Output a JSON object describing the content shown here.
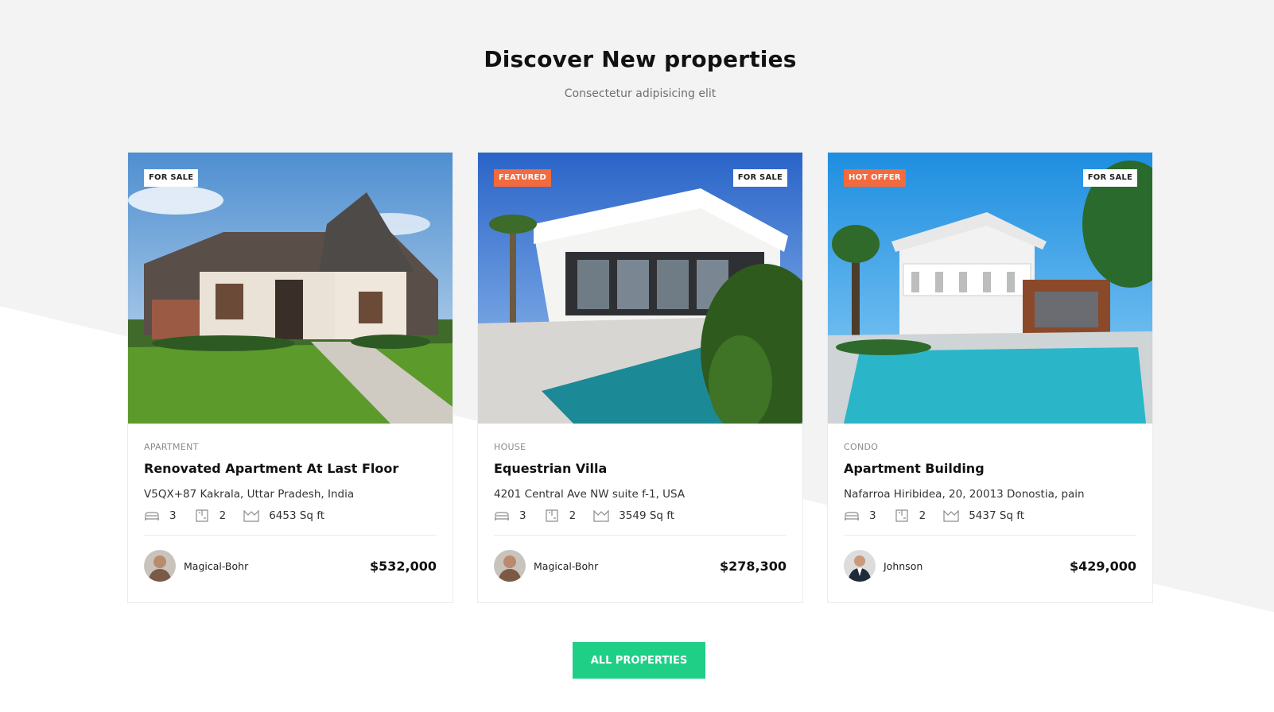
{
  "section": {
    "title": "Discover New properties",
    "subtitle": "Consectetur adipisicing elit"
  },
  "properties": [
    {
      "badges": [
        "FOR SALE"
      ],
      "category": "APARTMENT",
      "title": "Renovated Apartment At Last Floor",
      "address": "V5QX+87 Kakrala, Uttar Pradesh, India",
      "beds": "3",
      "baths": "2",
      "area": "6453 Sq ft",
      "agent": "Magical-Bohr",
      "price": "$532,000",
      "image": "white-brick-house-lawn"
    },
    {
      "badges": [
        "FEATURED",
        "FOR SALE"
      ],
      "category": "HOUSE",
      "title": "Equestrian Villa",
      "address": "4201 Central Ave NW suite f-1, USA",
      "beds": "3",
      "baths": "2",
      "area": "3549 Sq ft",
      "agent": "Magical-Bohr",
      "price": "$278,300",
      "image": "modern-villa-pool"
    },
    {
      "badges": [
        "HOT OFFER",
        "FOR SALE"
      ],
      "category": "CONDO",
      "title": "Apartment Building",
      "address": "Nafarroa Hiribidea, 20, 20013 Donostia, pain",
      "beds": "3",
      "baths": "2",
      "area": "5437 Sq ft",
      "agent": "Johnson",
      "price": "$429,000",
      "image": "white-house-pool-palms"
    }
  ],
  "cta": {
    "label": "ALL PROPERTIES"
  },
  "colors": {
    "accent": "#1fcf85",
    "badge_hot": "#f26a3d",
    "background": "#f3f3f3"
  },
  "icons": [
    "bed-icon",
    "bath-icon",
    "area-icon"
  ]
}
